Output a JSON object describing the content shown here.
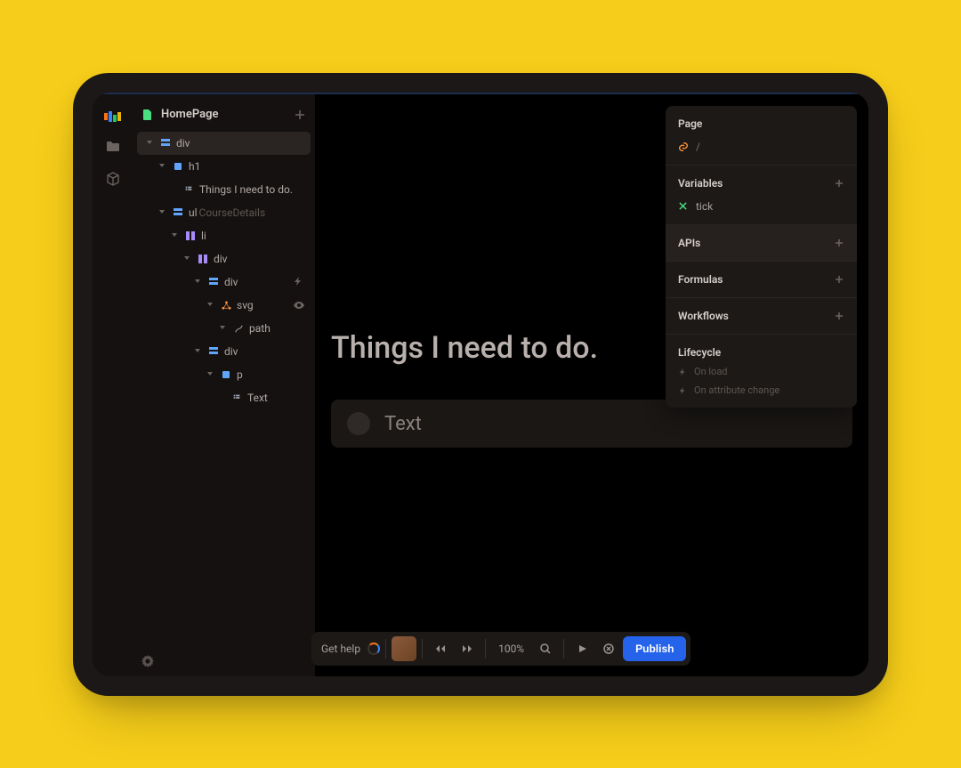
{
  "header": {
    "page_name": "HomePage"
  },
  "tree": {
    "root": {
      "label": "div"
    },
    "h1": {
      "label": "h1"
    },
    "h1_text": {
      "label": "Things I need to do."
    },
    "ul": {
      "label": "ul",
      "class": "CourseDetails"
    },
    "li": {
      "label": "li"
    },
    "div1": {
      "label": "div"
    },
    "div2": {
      "label": "div"
    },
    "svg": {
      "label": "svg"
    },
    "path": {
      "label": "path"
    },
    "div3": {
      "label": "div"
    },
    "p": {
      "label": "p"
    },
    "p_text": {
      "label": "Text"
    }
  },
  "canvas": {
    "heading": "Things I need to do.",
    "card_text": "Text"
  },
  "right": {
    "page_label": "Page",
    "page_path": "/",
    "variables_label": "Variables",
    "var1": "tick",
    "apis_label": "APIs",
    "formulas_label": "Formulas",
    "workflows_label": "Workflows",
    "lifecycle_label": "Lifecycle",
    "lc_onload": "On load",
    "lc_onattr": "On attribute change"
  },
  "bottom": {
    "help": "Get help",
    "zoom": "100%",
    "publish": "Publish"
  }
}
